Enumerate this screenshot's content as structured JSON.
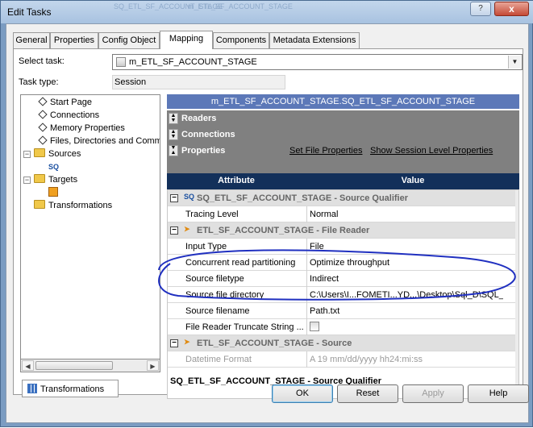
{
  "window": {
    "title": "Edit Tasks",
    "ghost_texts": [
      "SQ_ETL_SF_ACCOUNT_STAGE",
      "m_ETL_SF_ACCOUNT_STAGE"
    ],
    "help_symbol": "?",
    "close_symbol": "x"
  },
  "tabs": [
    "General",
    "Properties",
    "Config Object",
    "Mapping",
    "Components",
    "Metadata Extensions"
  ],
  "active_tab": "Mapping",
  "select_task": {
    "label": "Select task:",
    "value": "m_ETL_SF_ACCOUNT_STAGE"
  },
  "task_type": {
    "label": "Task type:",
    "value": "Session"
  },
  "tree": {
    "items": [
      {
        "label": "Start Page"
      },
      {
        "label": "Connections"
      },
      {
        "label": "Memory Properties"
      },
      {
        "label": "Files, Directories and Commands"
      }
    ],
    "sources": {
      "label": "Sources",
      "child_icon": "SQ"
    },
    "targets": {
      "label": "Targets"
    },
    "transformations": {
      "label": "Transformations"
    }
  },
  "bottom_tab": "Transformations",
  "right": {
    "mapping_header": "m_ETL_SF_ACCOUNT_STAGE.SQ_ETL_SF_ACCOUNT_STAGE",
    "sections": {
      "readers": "Readers",
      "connections": "Connections",
      "properties": "Properties"
    },
    "links": {
      "set_file": "Set File Properties",
      "show_session": "Show Session Level Properties"
    },
    "grid_headers": {
      "attribute": "Attribute",
      "value": "Value"
    },
    "groups": {
      "sq": {
        "icon": "SQ",
        "label": "SQ_ETL_SF_ACCOUNT_STAGE - Source Qualifier"
      },
      "file_reader": {
        "label": "ETL_SF_ACCOUNT_STAGE - File Reader"
      },
      "source": {
        "label": "ETL_SF_ACCOUNT_STAGE - Source"
      }
    },
    "rows": [
      {
        "attr": "Tracing Level",
        "val": "Normal"
      },
      {
        "attr": "Input Type",
        "val": "File"
      },
      {
        "attr": "Concurrent read partitioning",
        "val": "Optimize throughput"
      },
      {
        "attr": "Source filetype",
        "val": "Indirect"
      },
      {
        "attr": "Source file directory",
        "val": "C:\\Users\\I...FOMETI...YD...\\Desktop\\Sql_D\\SQL_D..."
      },
      {
        "attr": "Source filename",
        "val": "Path.txt"
      },
      {
        "attr": "File Reader Truncate String ...",
        "val": ""
      },
      {
        "attr": "Datetime Format",
        "val": "A  19 mm/dd/yyyy hh24:mi:ss"
      }
    ],
    "description": "SQ_ETL_SF_ACCOUNT_STAGE - Source Qualifier"
  },
  "buttons": {
    "ok": "OK",
    "reset": "Reset",
    "apply": "Apply",
    "help": "Help"
  }
}
